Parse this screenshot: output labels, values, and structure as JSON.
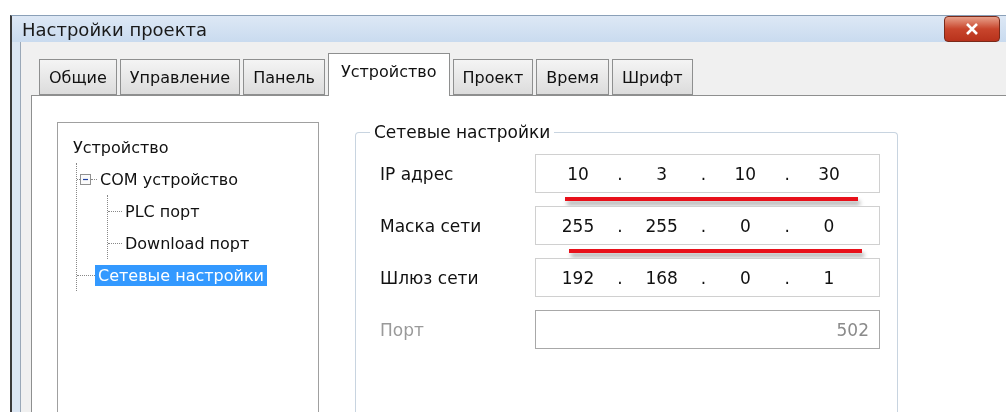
{
  "window": {
    "title": "Настройки проекта"
  },
  "tabs": [
    {
      "label": "Общие",
      "selected": false
    },
    {
      "label": "Управление",
      "selected": false
    },
    {
      "label": "Панель",
      "selected": false
    },
    {
      "label": "Устройство",
      "selected": true
    },
    {
      "label": "Проект",
      "selected": false
    },
    {
      "label": "Время",
      "selected": false
    },
    {
      "label": "Шрифт",
      "selected": false
    }
  ],
  "tree": [
    {
      "label": "Устройство",
      "selected": false,
      "children": [
        {
          "label": "COM устройство",
          "selected": false,
          "expanded": true,
          "children": [
            {
              "label": "PLC порт",
              "selected": false
            },
            {
              "label": "Download порт",
              "selected": false
            }
          ]
        },
        {
          "label": "Сетевые настройки",
          "selected": true
        }
      ]
    }
  ],
  "network": {
    "title": "Сетевые настройки",
    "fields": [
      {
        "kind": "ip",
        "label": "IP адрес",
        "octets": [
          "10",
          "3",
          "10",
          "30"
        ],
        "separator": ".",
        "disabled": false,
        "underlined": true
      },
      {
        "kind": "ip",
        "label": "Маска сети",
        "octets": [
          "255",
          "255",
          "0",
          "0"
        ],
        "separator": ".",
        "disabled": false,
        "underlined": true
      },
      {
        "kind": "ip",
        "label": "Шлюз сети",
        "octets": [
          "192",
          "168",
          "0",
          "1"
        ],
        "separator": ".",
        "disabled": false,
        "underlined": false
      },
      {
        "kind": "number",
        "label": "Порт",
        "value": "502",
        "disabled": true,
        "underlined": false
      }
    ]
  }
}
